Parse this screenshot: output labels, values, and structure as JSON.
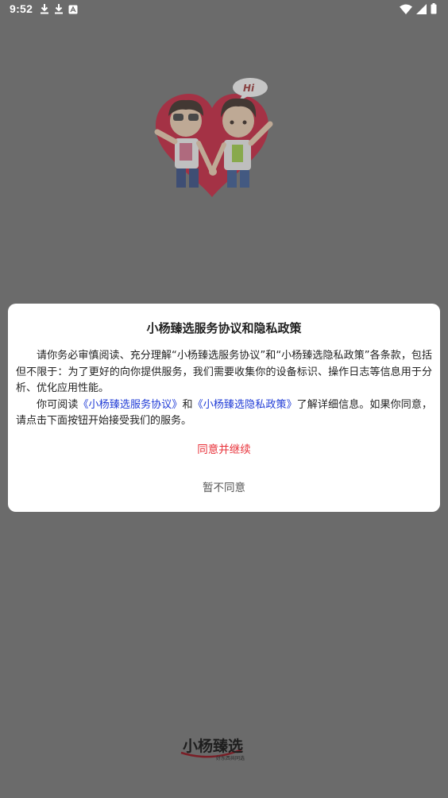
{
  "status_bar": {
    "time": "9:52",
    "notification_icons": [
      "download-icon",
      "download-icon",
      "app-notification-icon"
    ],
    "system_icons": [
      "wifi-icon",
      "signal-icon",
      "battery-icon"
    ]
  },
  "splash": {
    "bubble_text": "Hi"
  },
  "dialog": {
    "title": "小杨臻选服务协议和隐私政策",
    "para1": "请你务必审慎阅读、充分理解“小杨臻选服务协议”和“小杨臻选隐私政策”各条款，包括但不限于：为了更好的向你提供服务，我们需要收集你的设备标识、操作日志等信息用于分析、优化应用性能。",
    "para2_prefix": "你可阅读",
    "link_service": "《小杨臻选服务协议》",
    "para2_and": "和",
    "link_privacy": "《小杨臻选隐私政策》",
    "para2_suffix": "了解详细信息。如果你同意，请点击下面按钮开始接受我们的服务。",
    "agree_label": "同意并继续",
    "disagree_label": "暂不同意"
  },
  "brand": {
    "logo_text": "小杨臻选",
    "logo_subtext": "好东西共同选"
  },
  "colors": {
    "overlay": "#6b6b6b",
    "link": "#1f3bd6",
    "agree": "#e8323a",
    "heart": "#c8102e"
  }
}
